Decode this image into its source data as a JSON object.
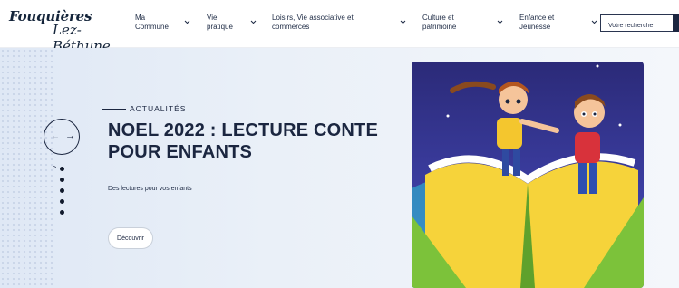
{
  "brand": {
    "line1": "Fouquières",
    "line2": "Lez-Béthune"
  },
  "nav": {
    "items": [
      {
        "label": "Ma\nCommune",
        "icon": "chevron-down-icon"
      },
      {
        "label": "Vie\npratique",
        "icon": "chevron-down-icon"
      },
      {
        "label": "Loisirs, Vie associative et\ncommerces",
        "icon": "chevron-down-icon"
      },
      {
        "label": "Culture et\npatrimoine",
        "icon": "chevron-down-icon"
      },
      {
        "label": "Enfance et\nJeunesse",
        "icon": "chevron-down-icon"
      }
    ]
  },
  "search": {
    "placeholder": "Votre recherche"
  },
  "hero": {
    "eyebrow": "ACTUALITÉS",
    "title": "NOEL 2022 : LECTURE CONTE POUR ENFANTS",
    "subtitle": "Des lectures pour vos enfants",
    "cta": "Découvrir",
    "carousel": {
      "prev_icon": "arrow-left-icon",
      "next_icon": "arrow-right-icon",
      "marker": ">",
      "slide_count": 5,
      "active_slide": 1
    }
  },
  "colors": {
    "primary": "#1b2640",
    "hero_bg": "#e6edf7",
    "illustration_bg": "#2f2f86",
    "book_green": "#7cc23a",
    "book_yellow": "#f6d33a"
  }
}
